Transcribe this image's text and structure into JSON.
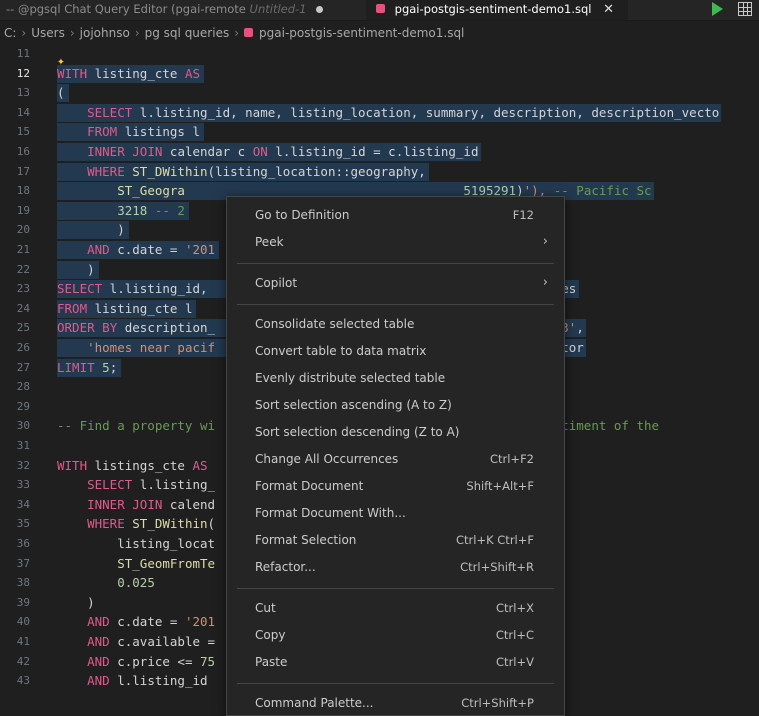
{
  "tabs": {
    "tab1_label": "-- @pgsql Chat Query Editor (pgai-remote",
    "tab1_status": "Untitled-1",
    "tab2_label": "pgai-postgis-sentiment-demo1.sql",
    "tab2_close": "✕"
  },
  "toolbar": {
    "run_icon": "play-icon",
    "grid_icon": "table-icon"
  },
  "breadcrumb": [
    "C:",
    "Users",
    "jojohnso",
    "pg sql queries",
    "pgai-postgis-sentiment-demo1.sql"
  ],
  "editor": {
    "active_line": "12",
    "lines": [
      {
        "n": "11",
        "t": ""
      },
      {
        "n": "12",
        "t": "WITH listing_cte AS"
      },
      {
        "n": "13",
        "t": "("
      },
      {
        "n": "14",
        "t": "    SELECT l.listing_id, name, listing_location, summary, description, description_vecto"
      },
      {
        "n": "15",
        "t": "    FROM listings l"
      },
      {
        "n": "16",
        "t": "    INNER JOIN calendar c ON l.listing_id = c.listing_id"
      },
      {
        "n": "17",
        "t": "    WHERE ST_DWithin(listing_location::geography,"
      },
      {
        "n": "18",
        "t": "        ST_Geogra                                     5195291)'), -- Pacific Sc"
      },
      {
        "n": "19",
        "t": "        3218 -- 2"
      },
      {
        "n": "20",
        "t": "        )"
      },
      {
        "n": "21",
        "t": "    AND c.date = '201"
      },
      {
        "n": "22",
        "t": "    )"
      },
      {
        "n": "23",
        "t": "SELECT l.listing_id,                                     n, amenities"
      },
      {
        "n": "24",
        "t": "FROM listing_cte l"
      },
      {
        "n": "25",
        "t": "ORDER BY description_                                  'embedding-03',"
      },
      {
        "n": "26",
        "t": "    'homes near pacif                                   cing')::vector"
      },
      {
        "n": "27",
        "t": "LIMIT 5;"
      },
      {
        "n": "28",
        "t": ""
      },
      {
        "n": "29",
        "t": ""
      },
      {
        "n": "30",
        "t": "-- Find a property wi                                  lyze the sentiment of the"
      },
      {
        "n": "31",
        "t": ""
      },
      {
        "n": "32",
        "t": "WITH listings_cte AS"
      },
      {
        "n": "33",
        "t": "    SELECT l.listing_                                  istings l"
      },
      {
        "n": "34",
        "t": "    INNER JOIN calend"
      },
      {
        "n": "35",
        "t": "    WHERE ST_DWithin("
      },
      {
        "n": "36",
        "t": "        listing_locat"
      },
      {
        "n": "37",
        "t": "        ST_GeomFromTe"
      },
      {
        "n": "38",
        "t": "        0.025"
      },
      {
        "n": "39",
        "t": "    )"
      },
      {
        "n": "40",
        "t": "    AND c.date = '201"
      },
      {
        "n": "41",
        "t": "    AND c.available ="
      },
      {
        "n": "42",
        "t": "    AND c.price <= 75"
      },
      {
        "n": "43",
        "t": "    AND l.listing_id"
      }
    ]
  },
  "context_menu": {
    "items": [
      {
        "label": "Go to Definition",
        "shortcut": "F12"
      },
      {
        "label": "Peek",
        "submenu": "›"
      },
      {
        "label": "Copilot",
        "submenu": "›"
      },
      {
        "label": "Consolidate selected table"
      },
      {
        "label": "Convert table to data matrix"
      },
      {
        "label": "Evenly distribute selected table"
      },
      {
        "label": "Sort selection ascending (A to Z)"
      },
      {
        "label": "Sort selection descending (Z to A)"
      },
      {
        "label": "Change All Occurrences",
        "shortcut": "Ctrl+F2"
      },
      {
        "label": "Format Document",
        "shortcut": "Shift+Alt+F"
      },
      {
        "label": "Format Document With..."
      },
      {
        "label": "Format Selection",
        "shortcut": "Ctrl+K Ctrl+F"
      },
      {
        "label": "Refactor...",
        "shortcut": "Ctrl+Shift+R"
      },
      {
        "label": "Cut",
        "shortcut": "Ctrl+X"
      },
      {
        "label": "Copy",
        "shortcut": "Ctrl+C"
      },
      {
        "label": "Paste",
        "shortcut": "Ctrl+V"
      },
      {
        "label": "Command Palette...",
        "shortcut": "Ctrl+Shift+P"
      }
    ]
  },
  "colors": {
    "keyword": "#e05a8b",
    "function": "#dcdcaa",
    "string": "#ce9178",
    "number": "#b5cea8",
    "comment": "#6a9955",
    "selection": "#264f78",
    "menu_bg": "#252526"
  }
}
